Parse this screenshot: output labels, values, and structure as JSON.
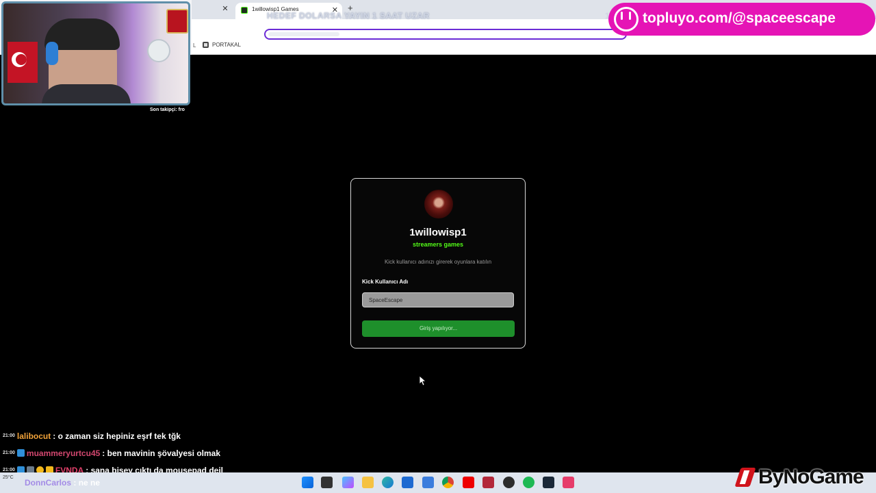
{
  "browser": {
    "tabs": [
      {
        "title": "1willowisp1 Games",
        "active": true
      }
    ],
    "bookmarks": [
      "PORTAKAL"
    ],
    "bookmark_tail": "L"
  },
  "stream_overlay": {
    "goal_text": "HEDEF DOLARSA YAYIN 1 SAAT UZAR",
    "goal_counter": "1",
    "goal_progress": 0.2,
    "promo_text": "topluyo.com/@spaceescape",
    "follower_label": "Son takipçi: fro"
  },
  "login_card": {
    "channel_name": "1willowisp1",
    "subtitle": "streamers games",
    "description": "Kick kullanıcı adınızı girerek oyunlara katılın",
    "field_label": "Kick Kullanıcı Adı",
    "field_value": "SpaceEscape",
    "submit_label": "Giriş yapılıyor...",
    "accent_color": "#53fc18",
    "button_color": "#1e8f2b"
  },
  "chat": [
    {
      "time": "21:00",
      "user": "lalibocut",
      "user_color": "#f2a33a",
      "message": ": o zaman siz hepiniz eşrf tek tğk"
    },
    {
      "time": "21:00",
      "user": "muammeryurtcu45",
      "user_color": "#d2476f",
      "message": ": ben mavinin şövalyesi olmak"
    },
    {
      "time": "21:00",
      "user": "FVNDA",
      "user_color": "#e2406a",
      "message": ": sana bisey cıktı da mousepad deil"
    },
    {
      "user": "DonnCarlos",
      "user_color": "#a38be6",
      "message": ": ne ne"
    }
  ],
  "taskbar": {
    "weather": "25°C",
    "icons": [
      "windows-icon",
      "files-icon",
      "copilot-icon",
      "folder-icon",
      "edge-icon",
      "store-icon",
      "mail-icon",
      "chrome-icon",
      "youtube-icon",
      "media-icon",
      "obs-icon",
      "spotify-icon",
      "steam-icon",
      "app-icon"
    ]
  },
  "watermark": "ByNoGame"
}
